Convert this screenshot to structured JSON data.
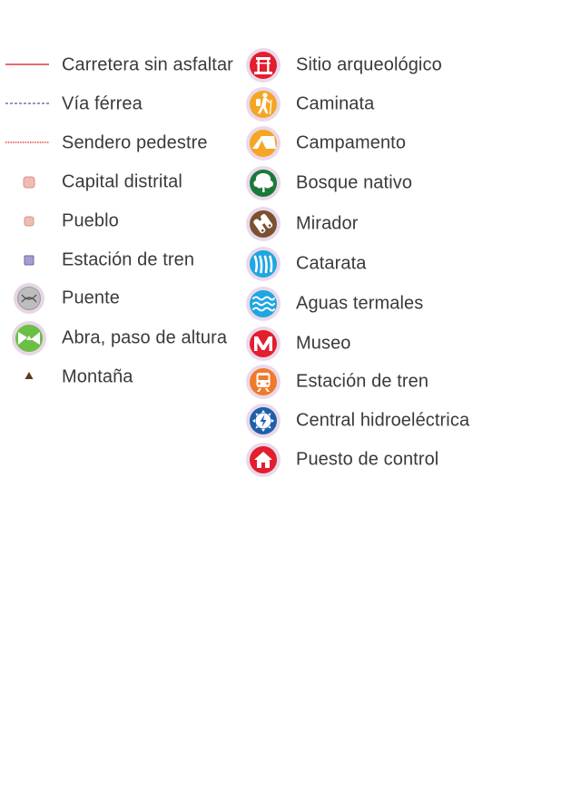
{
  "legend": {
    "left": [
      {
        "label": "Carretera sin asfaltar",
        "icon": "solid-red-line",
        "color": "#e03a3e"
      },
      {
        "label": "Vía férrea",
        "icon": "dashed-purple-line",
        "color": "#7b6fa8"
      },
      {
        "label": "Sendero pedestre",
        "icon": "dotted-red-line",
        "color": "#d9453a"
      },
      {
        "label": "Capital distrital",
        "icon": "rounded-square-pink",
        "color": "#e8aaa3"
      },
      {
        "label": "Pueblo",
        "icon": "small-square-pink",
        "color": "#e8aaa3"
      },
      {
        "label": "Estación de tren",
        "icon": "square-purple",
        "color": "#9e95c8"
      },
      {
        "label": "Puente",
        "icon": "bridge-icon",
        "color": "#b8b8b8"
      },
      {
        "label": "Abra, paso de altura",
        "icon": "pass-icon",
        "color": "#6bbf45"
      },
      {
        "label": "Montaña",
        "icon": "mountain-triangle",
        "color": "#5a3a1a"
      }
    ],
    "right": [
      {
        "label": "Sitio arqueológico",
        "icon": "archaeological-site-icon",
        "color": "#e31e2e"
      },
      {
        "label": "Caminata",
        "icon": "hiking-icon",
        "color": "#f5a623"
      },
      {
        "label": "Campamento",
        "icon": "tent-icon",
        "color": "#f5a623"
      },
      {
        "label": "Bosque nativo",
        "icon": "tree-icon",
        "color": "#1a7a3a"
      },
      {
        "label": "Mirador",
        "icon": "binoculars-icon",
        "color": "#7a5230"
      },
      {
        "label": "Catarata",
        "icon": "waterfall-icon",
        "color": "#1ea7e1"
      },
      {
        "label": "Aguas termales",
        "icon": "hot-springs-icon",
        "color": "#1ea7e1"
      },
      {
        "label": "Museo",
        "icon": "museum-icon",
        "color": "#e31e2e"
      },
      {
        "label": "Estación de tren",
        "icon": "train-icon",
        "color": "#f07a2a"
      },
      {
        "label": "Central hidroeléctrica",
        "icon": "hydroelectric-icon",
        "color": "#1f5fa8"
      },
      {
        "label": "Puesto de control",
        "icon": "checkpoint-house-icon",
        "color": "#e31e2e"
      }
    ]
  }
}
